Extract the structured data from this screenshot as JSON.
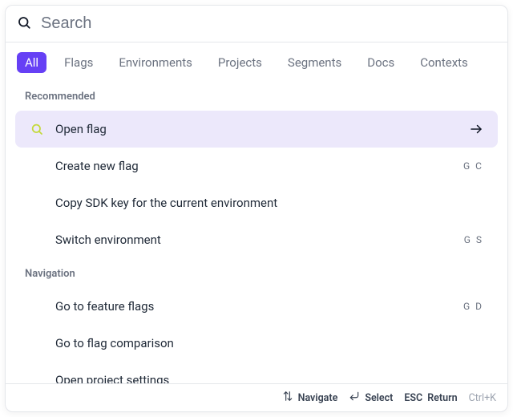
{
  "search": {
    "placeholder": "Search",
    "value": ""
  },
  "tabs": {
    "items": [
      {
        "label": "All",
        "active": true
      },
      {
        "label": "Flags",
        "active": false
      },
      {
        "label": "Environments",
        "active": false
      },
      {
        "label": "Projects",
        "active": false
      },
      {
        "label": "Segments",
        "active": false
      },
      {
        "label": "Docs",
        "active": false
      },
      {
        "label": "Contexts",
        "active": false
      }
    ]
  },
  "sections": [
    {
      "title": "Recommended",
      "items": [
        {
          "label": "Open flag",
          "shortcut": "",
          "selected": true,
          "icon": "search-icon-accent",
          "trail_icon": "arrow-right-icon"
        },
        {
          "label": "Create new flag",
          "shortcut": "G C",
          "selected": false
        },
        {
          "label": "Copy SDK key for the current environment",
          "shortcut": "",
          "selected": false
        },
        {
          "label": "Switch environment",
          "shortcut": "G S",
          "selected": false
        }
      ]
    },
    {
      "title": "Navigation",
      "items": [
        {
          "label": "Go to feature flags",
          "shortcut": "G D",
          "selected": false
        },
        {
          "label": "Go to flag comparison",
          "shortcut": "",
          "selected": false
        },
        {
          "label": "Open project settings",
          "shortcut": "",
          "selected": false
        }
      ]
    }
  ],
  "footer": {
    "navigate": "Navigate",
    "select": "Select",
    "esc": "ESC",
    "return": "Return",
    "shortcut": "Ctrl+K"
  }
}
